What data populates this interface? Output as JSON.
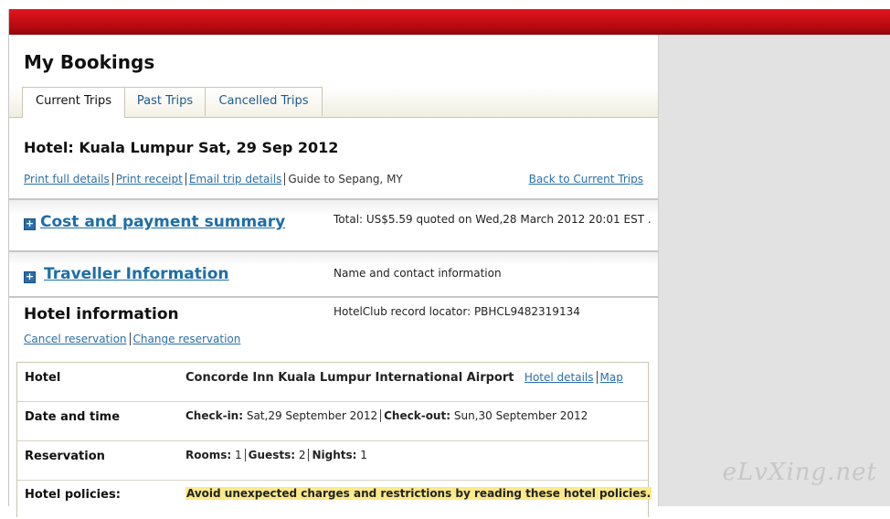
{
  "page": {
    "title": "My Bookings",
    "tabs": [
      {
        "label": "Current Trips"
      },
      {
        "label": "Past Trips"
      },
      {
        "label": "Cancelled Trips"
      }
    ]
  },
  "trip": {
    "title": "Hotel: Kuala Lumpur Sat, 29 Sep 2012",
    "links": {
      "print_full": "Print full details",
      "print_receipt": "Print receipt",
      "email_trip": "Email trip details",
      "guide": "Guide to Sepang, MY",
      "back": "Back to Current Trips"
    }
  },
  "cost": {
    "title": "Cost and payment summary",
    "note": "Total: US$5.59 quoted on Wed,28 March 2012 20:01 EST ."
  },
  "traveller": {
    "title": "Traveller Information",
    "note": "Name and contact information"
  },
  "hotel_info": {
    "title": "Hotel information",
    "locator": "HotelClub record locator: PBHCL9482319134",
    "cancel": "Cancel reservation",
    "change": "Change reservation",
    "rows": {
      "hotel": {
        "label": "Hotel",
        "name": "Concorde Inn Kuala Lumpur International Airport",
        "details_link": "Hotel details",
        "map_link": "Map"
      },
      "date": {
        "label": "Date and time",
        "checkin_label": "Check-in:",
        "checkin_value": "Sat,29 September 2012",
        "checkout_label": "Check-out:",
        "checkout_value": "Sun,30 September 2012"
      },
      "reservation": {
        "label": "Reservation",
        "rooms_label": "Rooms:",
        "rooms_value": "1",
        "guests_label": "Guests:",
        "guests_value": "2",
        "nights_label": "Nights:",
        "nights_value": "1"
      },
      "policies": {
        "label": "Hotel policies:",
        "text": "Avoid unexpected charges and restrictions by reading these hotel policies."
      }
    }
  },
  "watermark": "eLvXing.net"
}
